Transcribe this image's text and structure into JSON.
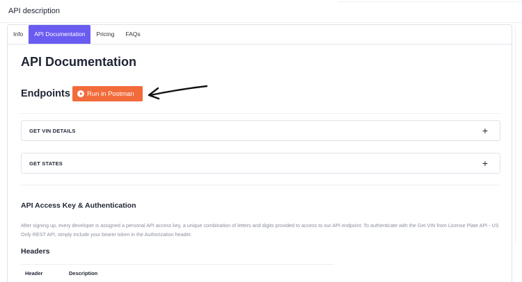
{
  "section_title": "API description",
  "tabs": [
    {
      "label": "Info",
      "active": false
    },
    {
      "label": "API Documentation",
      "active": true
    },
    {
      "label": "Pricing",
      "active": false
    },
    {
      "label": "FAQs",
      "active": false
    }
  ],
  "page_title": "API Documentation",
  "endpoints": {
    "label": "Endpoints",
    "postman_button": "Run in Postman",
    "items": [
      {
        "label": "GET VIN DETAILS",
        "expand_symbol": "+"
      },
      {
        "label": "GET STATES",
        "expand_symbol": "+"
      }
    ]
  },
  "auth": {
    "title": "API Access Key & Authentication",
    "text": "After signing up, every developer is assigned a personal API access key, a unique combination of letters and digits provided to access to our API endpoint. To authenticate with the Get VIN from License Plate API - US Only REST API, simply include your bearer token in the Authorization header."
  },
  "headers": {
    "title": "Headers",
    "columns": [
      "Header",
      "Description"
    ]
  },
  "colors": {
    "accent": "#6a5cf0",
    "postman": "#f26b3a",
    "text": "#1f2433",
    "muted": "#8a8f9c"
  },
  "icons": {
    "play": "play-circle-icon",
    "expand": "plus-icon",
    "annotation": "hand-drawn-arrow-icon"
  }
}
